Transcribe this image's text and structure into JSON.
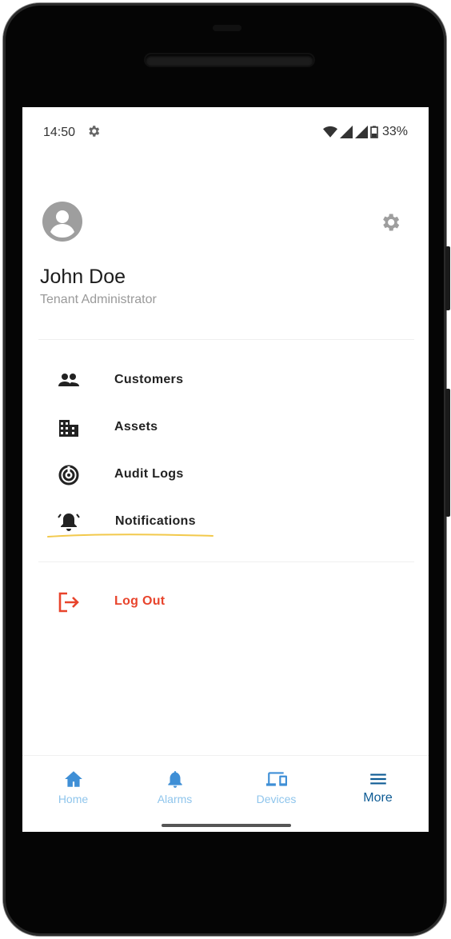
{
  "status_bar": {
    "time": "14:50",
    "battery": "33%"
  },
  "profile": {
    "name": "John Doe",
    "role": "Tenant Administrator"
  },
  "menu": [
    {
      "label": "Customers",
      "icon": "customers-icon"
    },
    {
      "label": "Assets",
      "icon": "assets-icon"
    },
    {
      "label": "Audit Logs",
      "icon": "audit-logs-icon"
    },
    {
      "label": "Notifications",
      "icon": "notifications-icon"
    }
  ],
  "logout": {
    "label": "Log Out",
    "icon": "logout-icon"
  },
  "bottom_nav": [
    {
      "label": "Home",
      "icon": "home-icon"
    },
    {
      "label": "Alarms",
      "icon": "bell-icon"
    },
    {
      "label": "Devices",
      "icon": "devices-icon"
    },
    {
      "label": "More",
      "icon": "menu-icon",
      "active": true
    }
  ],
  "colors": {
    "accent": "#0d5b94",
    "nav_inactive": "#8fc5ec",
    "logout": "#e8442c",
    "highlight": "#f2c94c"
  }
}
